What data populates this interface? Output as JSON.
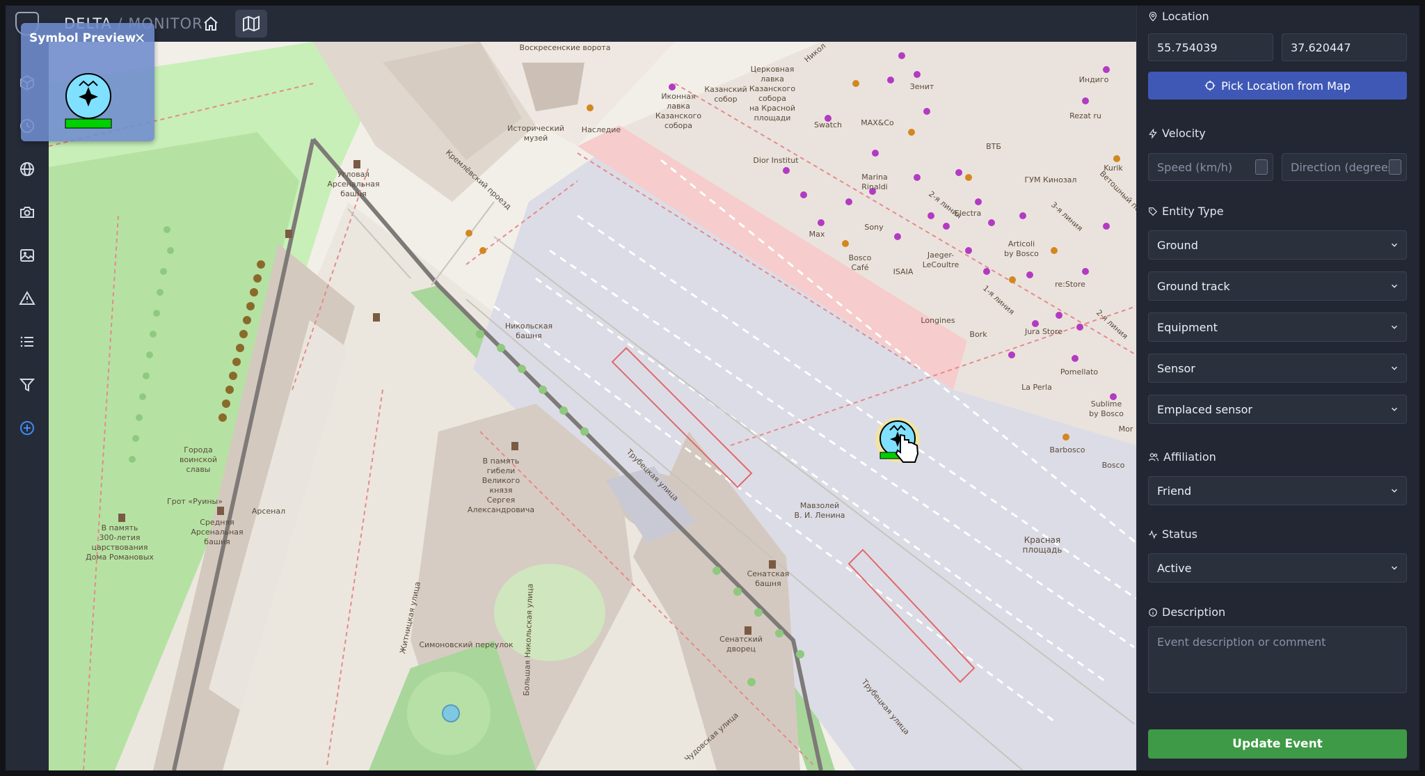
{
  "app": {
    "brand": "DELTA",
    "brand_sep": " / ",
    "brand_sub": "MONITOR"
  },
  "preview": {
    "title": "Symbol Preview",
    "close": "×"
  },
  "panel": {
    "location": {
      "label": "Location",
      "lat": "55.754039",
      "lon": "37.620447",
      "pick_label": "Pick Location from Map"
    },
    "velocity": {
      "label": "Velocity",
      "speed_placeholder": "Speed (km/h)",
      "direction_placeholder": "Direction (degrees)"
    },
    "entity_type": {
      "label": "Entity Type",
      "selects": [
        "Ground",
        "Ground track",
        "Equipment",
        "Sensor",
        "Emplaced sensor"
      ]
    },
    "affiliation": {
      "label": "Affiliation",
      "value": "Friend"
    },
    "status": {
      "label": "Status",
      "value": "Active"
    },
    "description": {
      "label": "Description",
      "placeholder": "Event description or comment"
    },
    "update_label": "Update Event"
  },
  "map_labels": {
    "vorota": "Воскресенские ворота",
    "kazan1": "Казанский",
    "kazan2": "собор",
    "ikon1": "Иконная",
    "ikon2": "лавка",
    "ikon3": "Казанского",
    "ikon4": "собора",
    "cerk1": "Церковная",
    "cerk2": "лавка",
    "cerk3": "Казанского",
    "cerk4": "собора",
    "cerk5": "на Красной",
    "cerk6": "площади",
    "istor1": "Исторический",
    "istor2": "музей",
    "nasledie": "Наследие",
    "kreml_proezd": "Кремлёвский проезд",
    "uglov1": "Угловая",
    "uglov2": "Арсенальная",
    "uglov3": "башня",
    "nikol1": "Никольская",
    "nikol2": "башня",
    "goroda1": "Города",
    "goroda2": "воинской",
    "goroda3": "славы",
    "grot": "Грот «Руины»",
    "arsenal": "Арсенал",
    "sred1": "Средняя",
    "sred2": "Арсенальная",
    "sred3": "башня",
    "pamyat1": "В память",
    "pamyat2": "300-летия",
    "pamyat3": "царствования",
    "pamyat4": "Дома Романовых",
    "gibel1": "В память",
    "gibel2": "гибели",
    "gibel3": "Великого",
    "gibel4": "князя",
    "gibel5": "Сергея",
    "gibel6": "Александровича",
    "trub1": "Трубецкая улица",
    "mavz1": "Мавзолей",
    "mavz2": "В. И. Ленина",
    "senat1": "Сенатская",
    "senat2": "башня",
    "senat_dvorec1": "Сенатский",
    "senat_dvorec2": "дворец",
    "zhit": "Житницкая улица",
    "simon": "Симоновский переулок",
    "bnikol": "Большая Никольская улица",
    "chudov": "Чудовская улица",
    "trub2": "Трубецкая улица",
    "krasn1": "Красная",
    "krasn2": "площадь",
    "zenit": "Зенит",
    "swatch": "Swatch",
    "maxco": "MAX&Co",
    "vtb": "ВТБ",
    "dior": "Dior Institut",
    "marina1": "Marina",
    "marina2": "Rinaldi",
    "gum": "ГУМ Кинозал",
    "liniya2": "2-я линия",
    "liniya3": "3-я линия",
    "electra": "Electra",
    "sony": "Sony",
    "max": "Max",
    "bosco1": "Bosco",
    "bosco2": "Café",
    "isaia": "ISAIA",
    "jaeger1": "Jaeger-",
    "jaeger2": "LeCoultre",
    "articoli1": "Articoli",
    "articoli2": "by Bosco",
    "restore": "re:Store",
    "liniya1": "1-я линия",
    "longines": "Longines",
    "bork": "Bork",
    "jura": "Jura Store",
    "lapera": "La Perla",
    "pomellato": "Pomellato",
    "sublime1": "Sublime",
    "sublime2": "by Bosco",
    "barbosco": "Barbosco",
    "bosco3": "Bosco",
    "nikol_ul": "Никол",
    "vetosh": "Ветошный пер.",
    "indigo": "Индиго",
    "rezat": "Rezat ru",
    "kurik": "Kurik",
    "mor": "Mor"
  },
  "colors": {
    "accent": "#3f58b6",
    "success": "#3e9a46",
    "friend": "#80e0ff",
    "panel_bg": "#232733"
  },
  "icons": [
    "home-icon",
    "map-icon",
    "cube-icon",
    "clock-icon",
    "globe-icon",
    "camera-icon",
    "image-icon",
    "alert-icon",
    "list-icon",
    "filter-icon",
    "add-circle-icon",
    "pin-icon",
    "crosshair-icon",
    "bolt-icon",
    "tag-icon",
    "users-icon",
    "activity-icon",
    "info-icon",
    "chevron-down-icon"
  ]
}
